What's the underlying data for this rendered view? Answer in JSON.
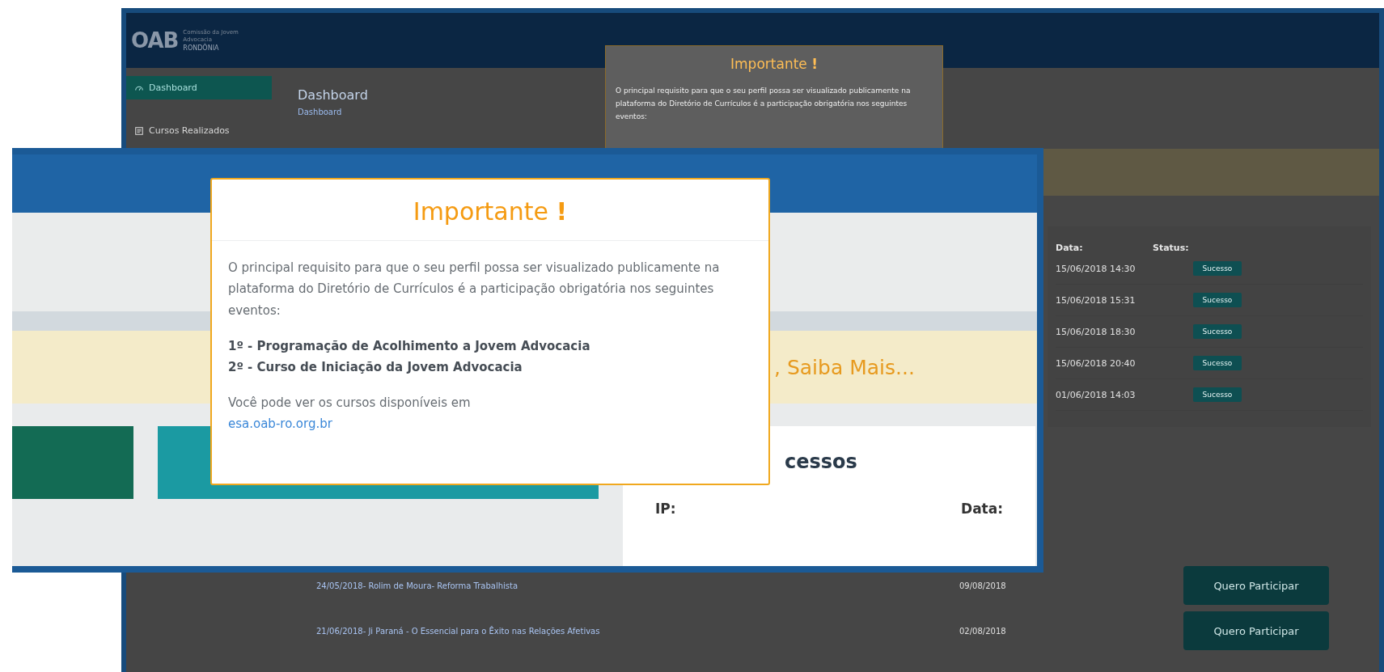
{
  "back_screen": {
    "logo": {
      "mark": "OAB",
      "region": "RONDÔNIA",
      "caption": "Comissão da Jovem Advocacia"
    },
    "sidebar": {
      "items": [
        {
          "label": "Dashboard",
          "selected": true
        },
        {
          "label": "Cursos Realizados",
          "selected": false
        }
      ]
    },
    "page_title": "Dashboard",
    "breadcrumb": "Dashboard",
    "modal": {
      "title": "Importante **!**",
      "text": "O principal requisito para que o seu perfil possa ser visualizado publicamente na plataforma do Diretório de Currículos é a participação obrigatória nos seguintes eventos:"
    },
    "access_table": {
      "columns": [
        "Data:",
        "Status:"
      ],
      "rows": [
        {
          "date": "15/06/2018 14:30",
          "status": "Sucesso"
        },
        {
          "date": "15/06/2018 15:31",
          "status": "Sucesso"
        },
        {
          "date": "15/06/2018 18:30",
          "status": "Sucesso"
        },
        {
          "date": "15/06/2018 20:40",
          "status": "Sucesso"
        },
        {
          "date": "01/06/2018 14:03",
          "status": "Sucesso"
        }
      ]
    },
    "courses": [
      {
        "title": "24/05/2018- Rolim de Moura- Reforma Trabalhista",
        "date": "09/08/2018",
        "button": "Quero Participar"
      },
      {
        "title": "21/06/2018- Ji Paraná - O Essencial para o Êxito nas Relações Afetivas",
        "date": "02/08/2018",
        "button": "Quero Participar"
      }
    ]
  },
  "front_screen": {
    "banner_text": ", Saiba Mais...",
    "access_panel": {
      "heading": "cessos",
      "columns": [
        "IP:",
        "Data:"
      ]
    },
    "modal": {
      "title": "Importante **!**",
      "paragraph": "O principal requisito para que o seu perfil possa ser visualizado publicamente na plataforma do Diretório de Currículos é a participação obrigatória nos seguintes eventos:",
      "events": [
        "1º - Programação de Acolhimento a Jovem Advocacia",
        "2º - Curso de Iniciação da Jovem Advocacia"
      ],
      "note": "Você pode ver os cursos disponíveis em",
      "link": "esa.oab-ro.org.br"
    }
  }
}
